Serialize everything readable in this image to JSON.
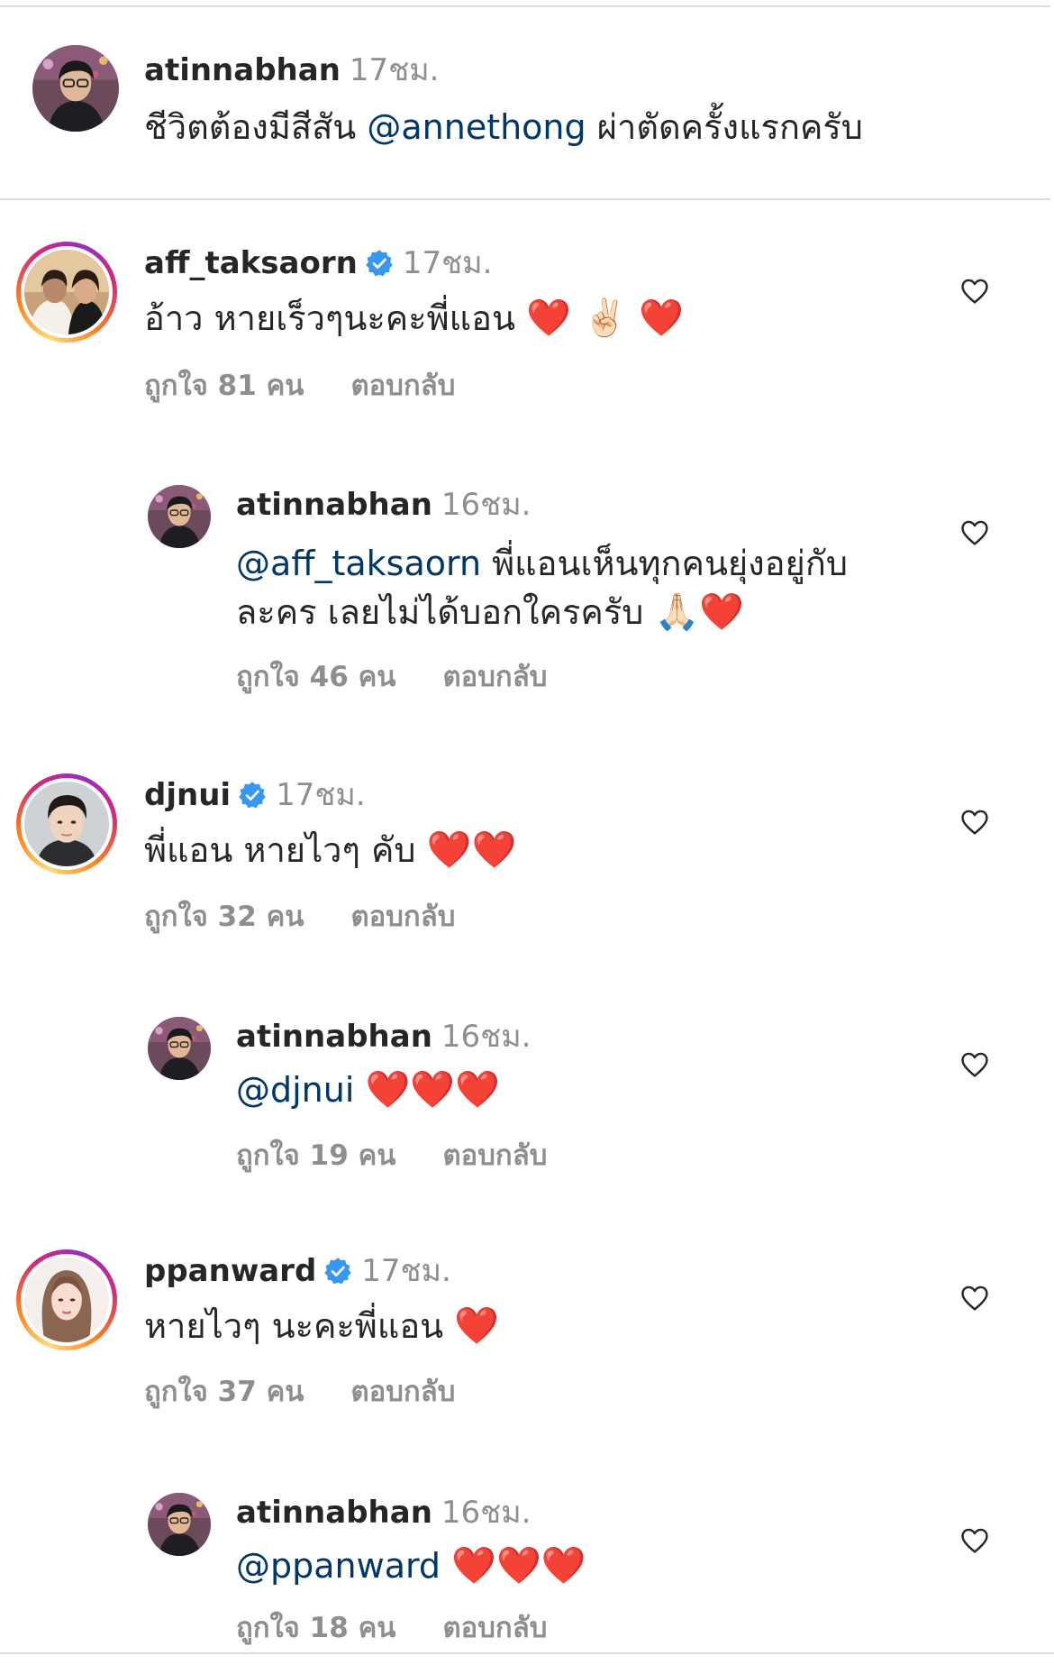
{
  "caption": {
    "username": "atinnabhan",
    "time": "17ชม.",
    "text_before": "ชีวิตต้องมีสีสัน ",
    "mention": "@annethong",
    "text_after": " ผ่าตัดครั้งแรกครับ"
  },
  "comments": [
    {
      "username": "aff_taksaorn",
      "verified": true,
      "time": "17ชม.",
      "text": "อ้าว หายเร็วๆนะคะพี่แอน",
      "emoji": "❤️ ✌🏻 ❤️",
      "likes": "ถูกใจ 81 คน",
      "reply_label": "ตอบกลับ",
      "avatar_icon": "profile-photo",
      "like_icon": "heart-outline-icon"
    },
    {
      "username": "atinnabhan",
      "verified": false,
      "time": "16ชม.",
      "mention": "@aff_taksaorn",
      "text": " พี่แอนเห็นทุกคนยุ่งอยู่กับละคร เลยไม่ได้บอกใครครับ ",
      "emoji": "🙏🏻❤️",
      "likes": "ถูกใจ 46 คน",
      "reply_label": "ตอบกลับ"
    },
    {
      "username": "djnui",
      "verified": true,
      "time": "17ชม.",
      "text": "พี่แอน หายไวๆ คับ",
      "emoji": "❤️❤️",
      "likes": "ถูกใจ 32 คน",
      "reply_label": "ตอบกลับ"
    },
    {
      "username": "atinnabhan",
      "verified": false,
      "time": "16ชม.",
      "mention": "@djnui",
      "emoji": "❤️❤️❤️",
      "likes": "ถูกใจ 19 คน",
      "reply_label": "ตอบกลับ"
    },
    {
      "username": "ppanward",
      "verified": true,
      "time": "17ชม.",
      "text": "หายไวๆ นะคะพี่แอน",
      "emoji": "❤️",
      "likes": "ถูกใจ 37 คน",
      "reply_label": "ตอบกลับ"
    },
    {
      "username": "atinnabhan",
      "verified": false,
      "time": "16ชม.",
      "mention": "@ppanward",
      "emoji": "❤️❤️❤️",
      "likes": "ถูกใจ 18 คน",
      "reply_label": "ตอบกลับ"
    }
  ],
  "colors": {
    "text": "#262626",
    "secondary": "#8e8e8e",
    "mention": "#00376b",
    "verified": "#3897f0",
    "divider": "#dbdbdb"
  }
}
